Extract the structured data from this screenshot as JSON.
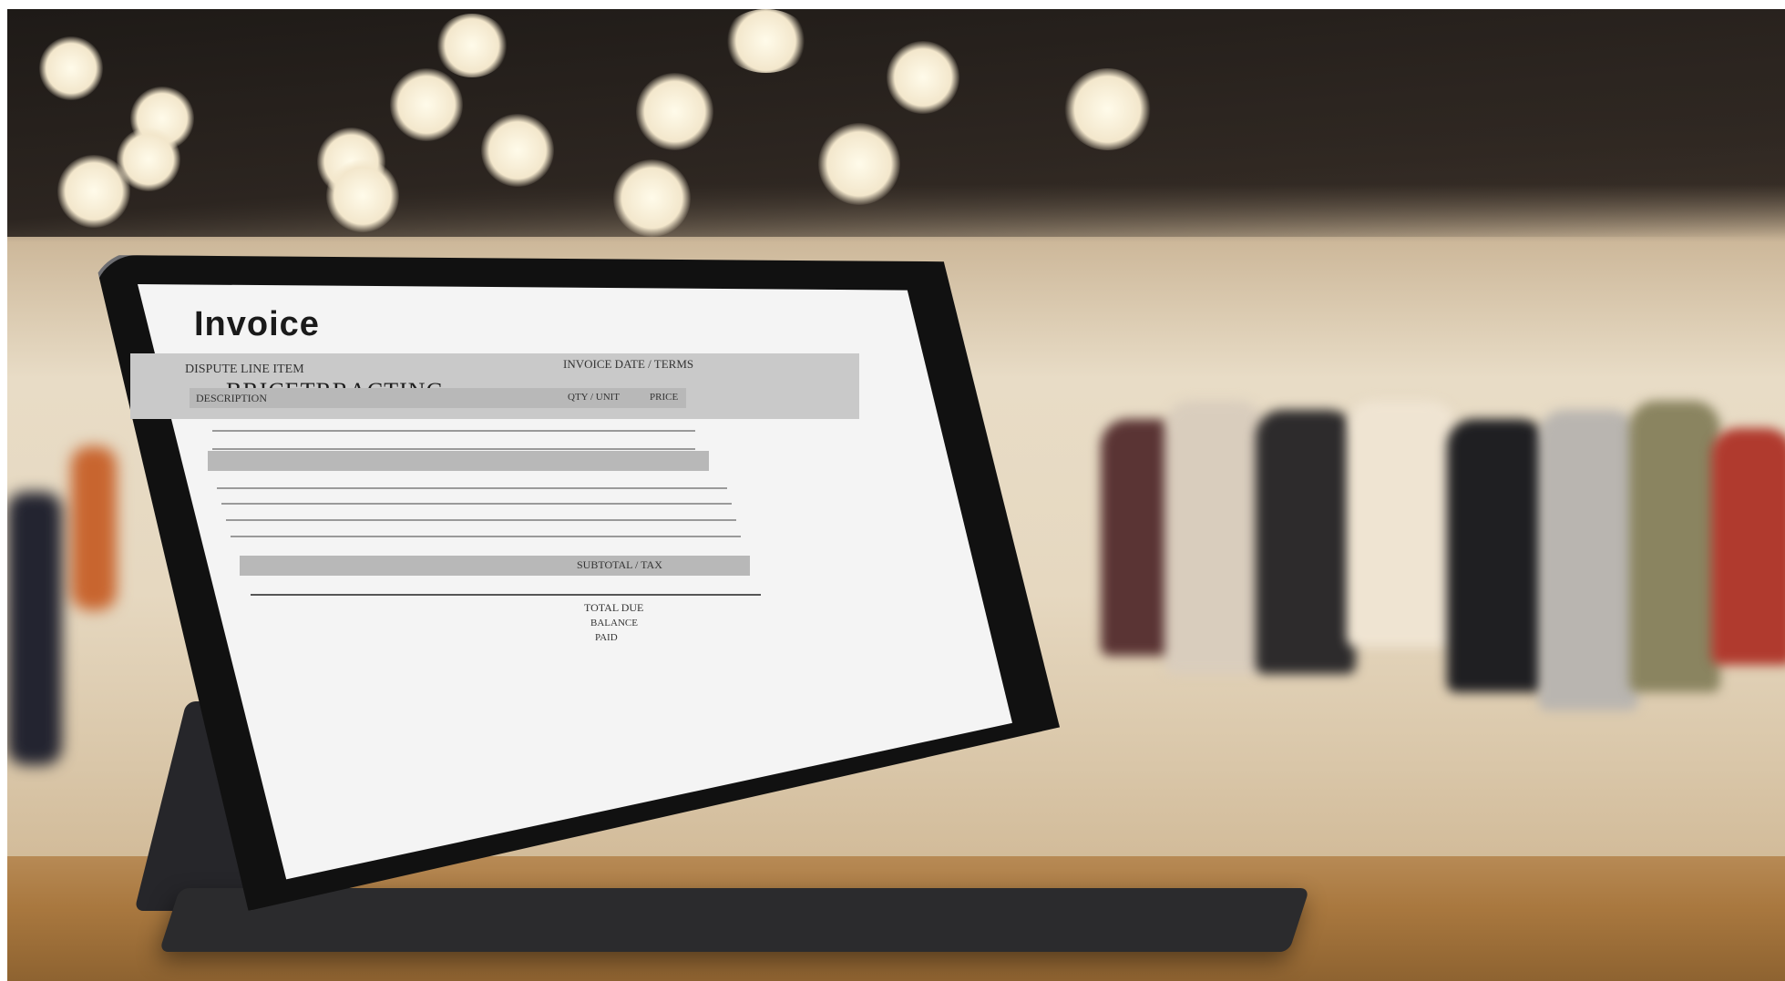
{
  "tablet_screen": {
    "title": "Invoice",
    "banner": "BRICETRRACTING",
    "faint_lines": [
      "DISPUTE LINE ITEM",
      "INVOICE DATE / TERMS",
      "DESCRIPTION",
      "QTY / UNIT",
      "PRICE"
    ],
    "totals_label": "SUBTOTAL / TAX",
    "footer_lines": [
      "TOTAL DUE",
      "BALANCE",
      "PAID"
    ]
  },
  "colors": {
    "screen_bg": "#f4f4f4",
    "band_gray": "#c9c9c9",
    "table_wood": "#a9783f"
  }
}
